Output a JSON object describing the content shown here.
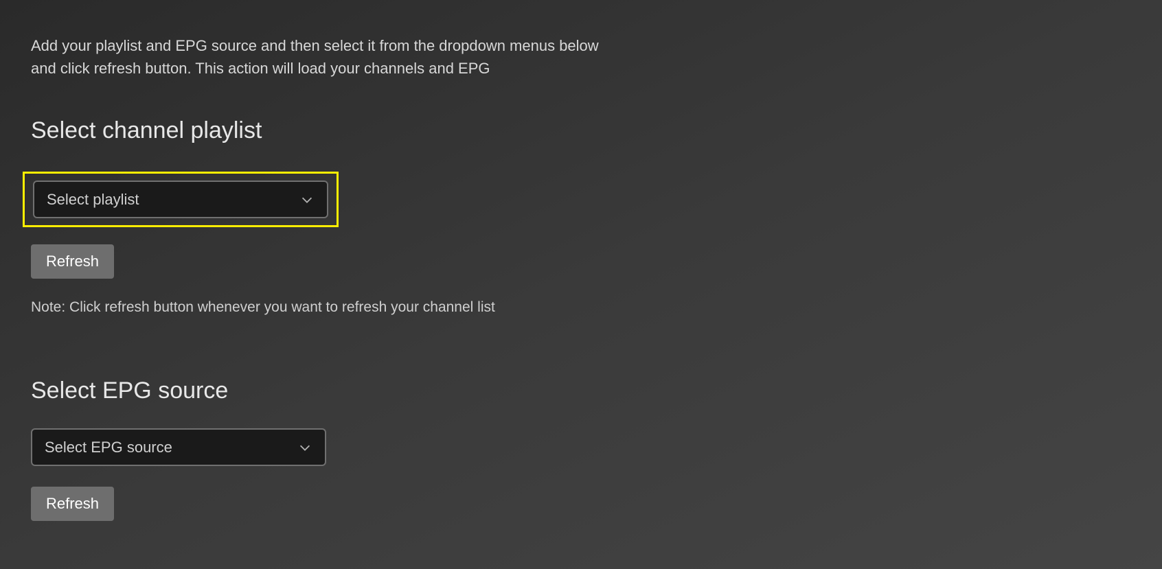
{
  "intro": "Add your playlist and EPG source and then select it from the dropdown menus below and click refresh button. This action will load your channels and EPG",
  "playlist_section": {
    "heading": "Select channel playlist",
    "dropdown_label": "Select playlist",
    "refresh_label": "Refresh",
    "note": "Note: Click refresh button whenever you want to refresh your channel list"
  },
  "epg_section": {
    "heading": "Select EPG source",
    "dropdown_label": "Select EPG source",
    "refresh_label": "Refresh"
  },
  "colors": {
    "highlight": "#ffee00",
    "background_dark": "#1a1a1a",
    "border": "#707070",
    "button": "#6e6e6e"
  }
}
